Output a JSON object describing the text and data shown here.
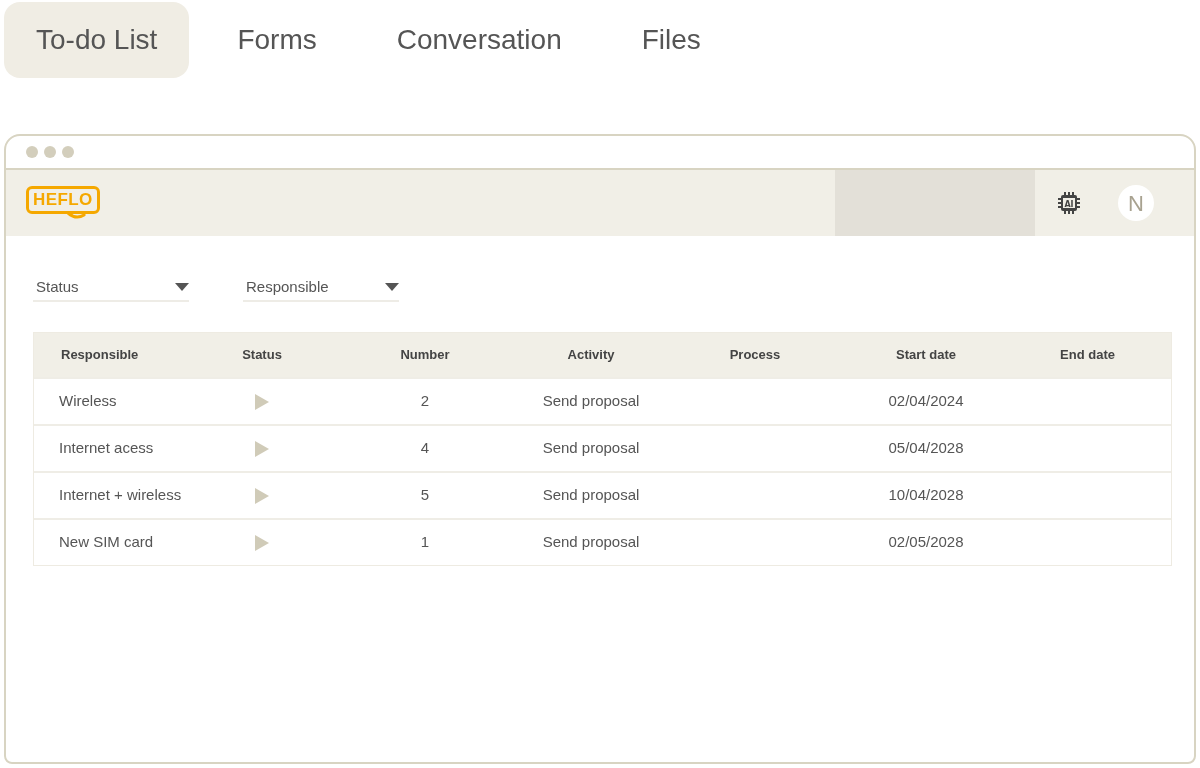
{
  "tabs": [
    {
      "label": "To-do List",
      "selected": true
    },
    {
      "label": "Forms",
      "selected": false
    },
    {
      "label": "Conversation",
      "selected": false
    },
    {
      "label": "Files",
      "selected": false
    }
  ],
  "header": {
    "logo": "HEFLO",
    "chip_label": "AI",
    "avatar": "N"
  },
  "filters": [
    {
      "label": "Status"
    },
    {
      "label": "Responsible"
    }
  ],
  "table": {
    "columns": [
      "Responsible",
      "Status",
      "Number",
      "Activity",
      "Process",
      "Start date",
      "End date"
    ],
    "rows": [
      {
        "responsible": "Wireless",
        "number": "2",
        "activity": "Send proposal",
        "start_date": "02/04/2024"
      },
      {
        "responsible": "Internet acess",
        "number": "4",
        "activity": "Send proposal",
        "start_date": "05/04/2028"
      },
      {
        "responsible": "Internet + wireless",
        "number": "5",
        "activity": "Send proposal",
        "start_date": "10/04/2028"
      },
      {
        "responsible": "New SIM card",
        "number": "1",
        "activity": "Send proposal",
        "start_date": "02/05/2028"
      }
    ]
  }
}
